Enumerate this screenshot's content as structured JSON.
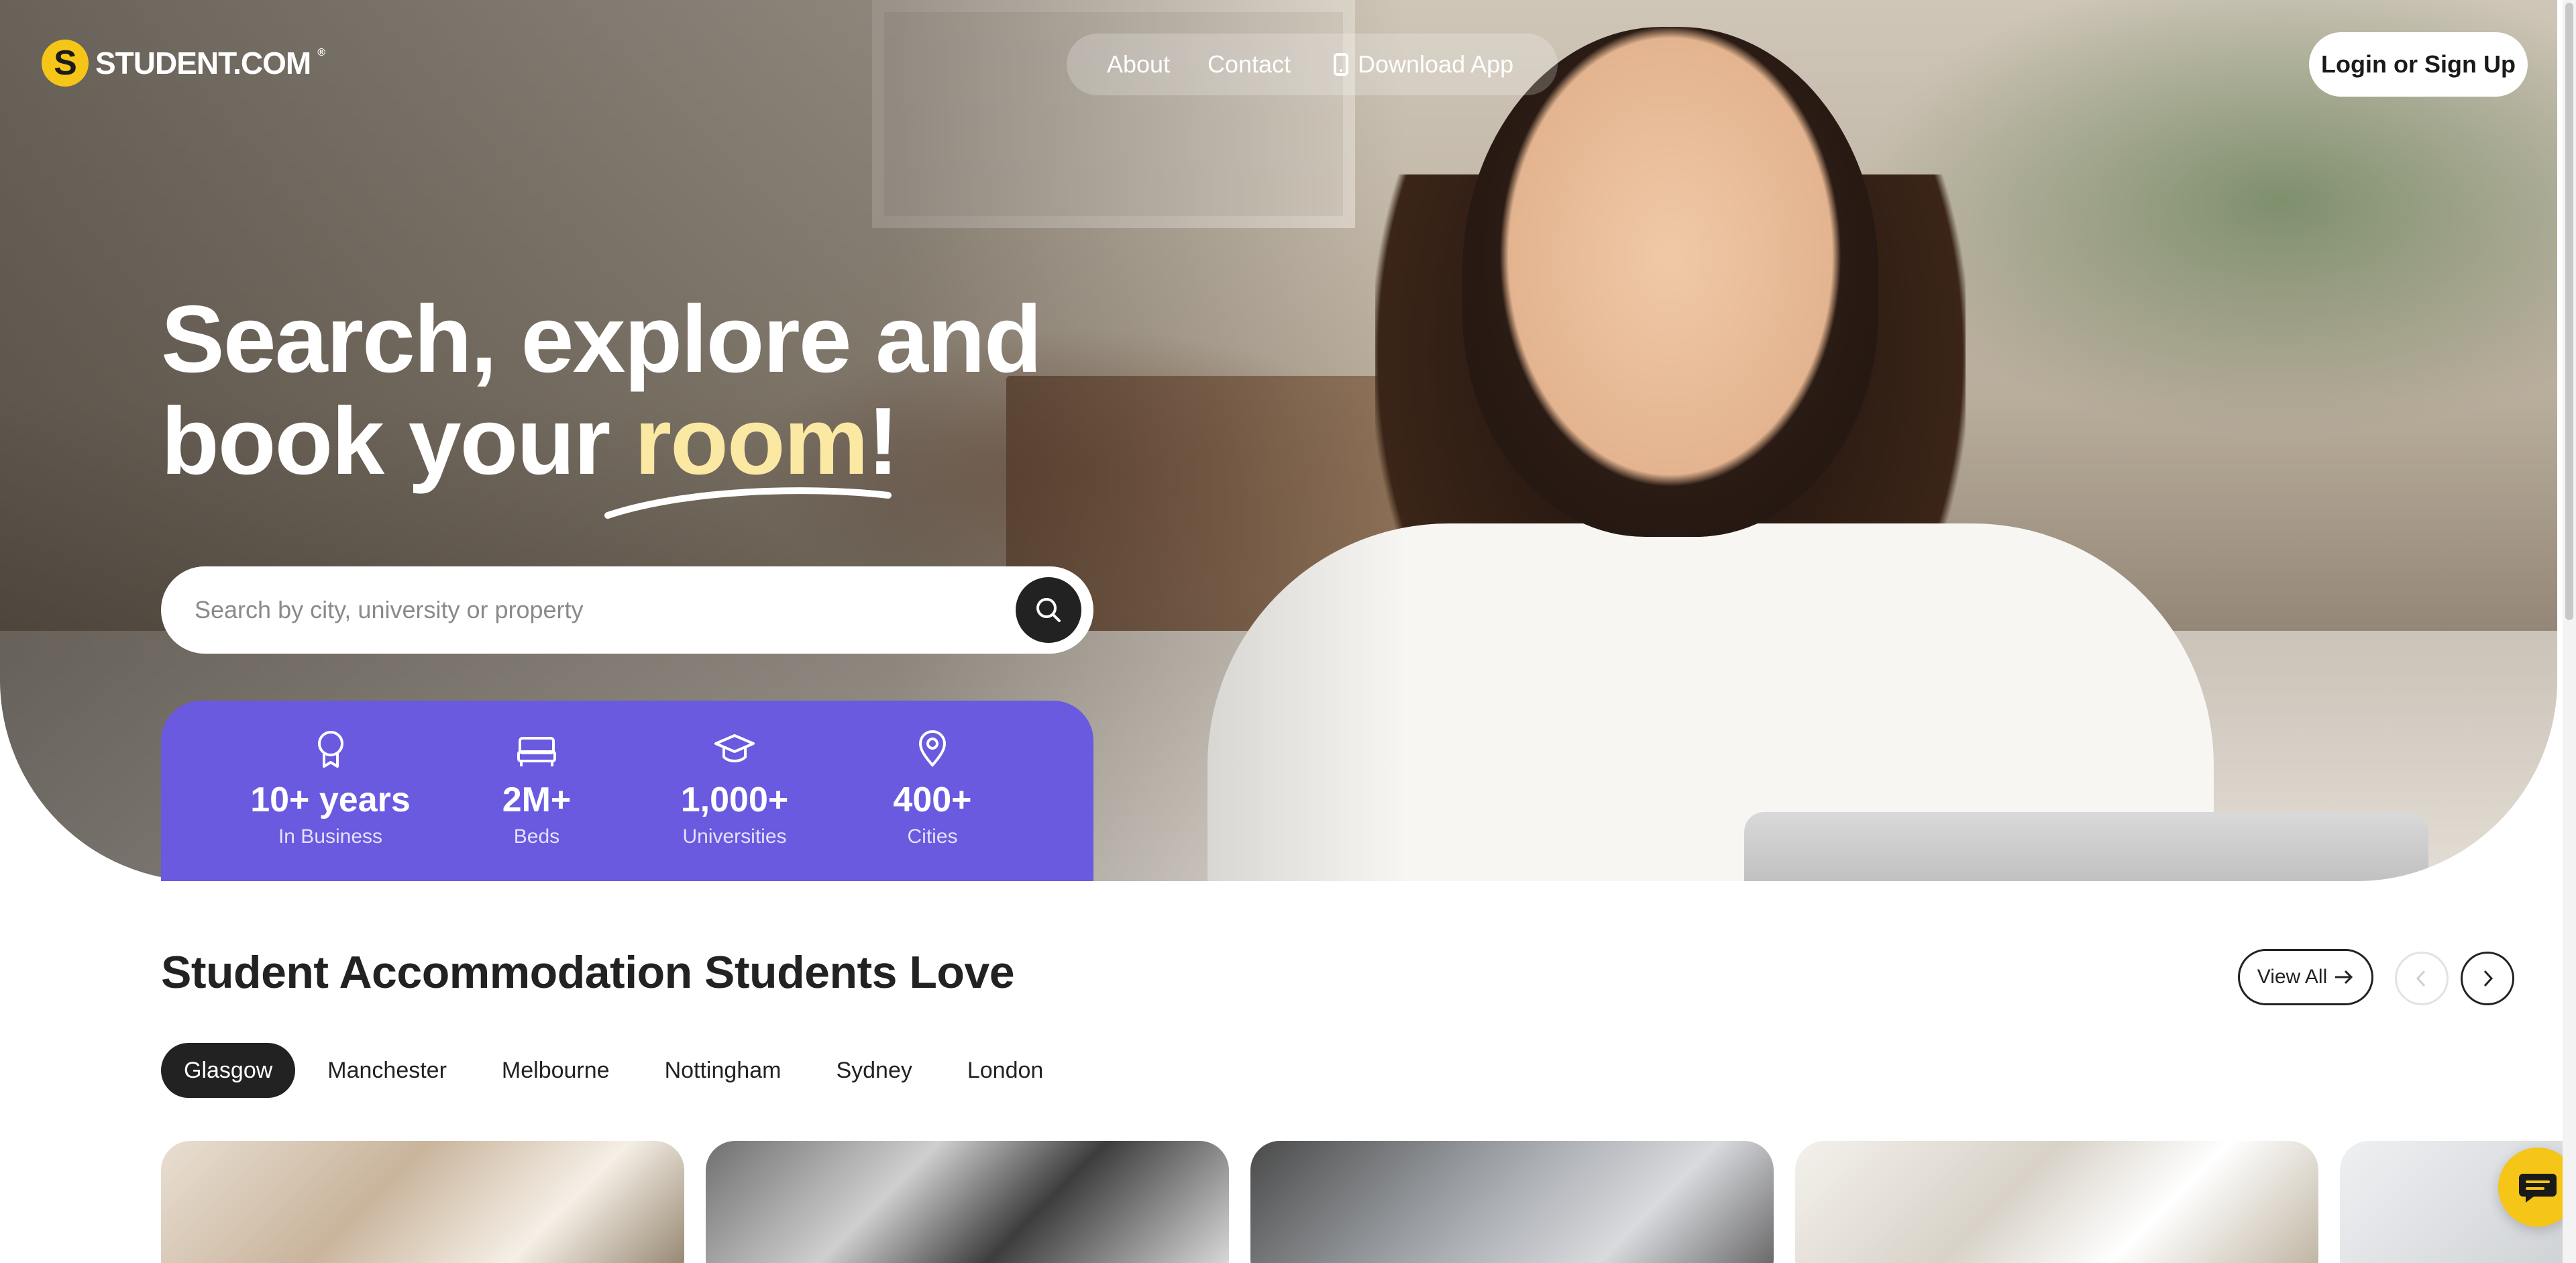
{
  "brand": {
    "name": "STUDENT.COM",
    "mark": "S",
    "reg": "®",
    "accent_color": "#f5c518"
  },
  "nav": {
    "about": "About",
    "contact": "Contact",
    "download_app": "Download App",
    "login": "Login or Sign Up"
  },
  "hero": {
    "headline_line1": "Search, explore and",
    "headline_line2_pre": "book your ",
    "headline_accent": "room",
    "headline_end": "!",
    "search_placeholder": "Search by city, university or property"
  },
  "stats": [
    {
      "icon": "award-icon",
      "value": "10+ years",
      "label": "In Business"
    },
    {
      "icon": "bed-icon",
      "value": "2M+",
      "label": "Beds"
    },
    {
      "icon": "graduation-cap-icon",
      "value": "1,000+",
      "label": "Universities"
    },
    {
      "icon": "location-pin-icon",
      "value": "400+",
      "label": "Cities"
    }
  ],
  "stats_color": "#6a5ae0",
  "section": {
    "title": "Student Accommodation Students Love",
    "view_all": "View All"
  },
  "cities": [
    "Glasgow",
    "Manchester",
    "Melbourne",
    "Nottingham",
    "Sydney",
    "London"
  ],
  "active_city": "Glasgow"
}
